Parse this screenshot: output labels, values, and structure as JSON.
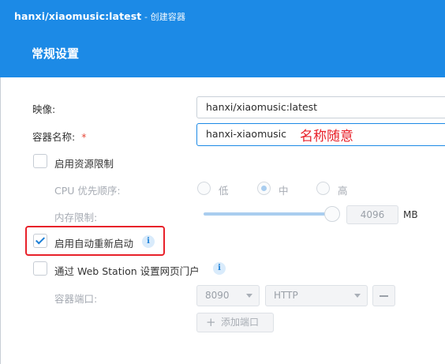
{
  "window": {
    "app_name": "hanxi/xiaomusic:latest",
    "separator": " - ",
    "action": "创建容器"
  },
  "section_title": "常规设置",
  "form": {
    "image_label": "映像:",
    "image_value": "hanxi/xiaomusic:latest",
    "container_name_label": "容器名称:",
    "required_mark": "*",
    "container_name_value": "hanxi-xiaomusic",
    "annotation": "名称随意",
    "resource_limit_label": "启用资源限制",
    "cpu_priority_label": "CPU 优先顺序:",
    "cpu_options": [
      "低",
      "中",
      "高"
    ],
    "cpu_selected": "中",
    "memory_limit_label": "内存限制:",
    "memory_value": "4096",
    "memory_unit": "MB",
    "memory_slider_fraction": 0.93,
    "auto_restart_label": "启用自动重新启动",
    "auto_restart_checked": true,
    "web_station_label": "通过 Web Station 设置网页门户",
    "container_port_label": "容器端口:",
    "port_value": "8090",
    "protocol_value": "HTTP",
    "add_port_label": "添加端口"
  },
  "colors": {
    "header": "#1c8ae6",
    "accent": "#1c7fd6",
    "annotation": "#e8212a"
  }
}
